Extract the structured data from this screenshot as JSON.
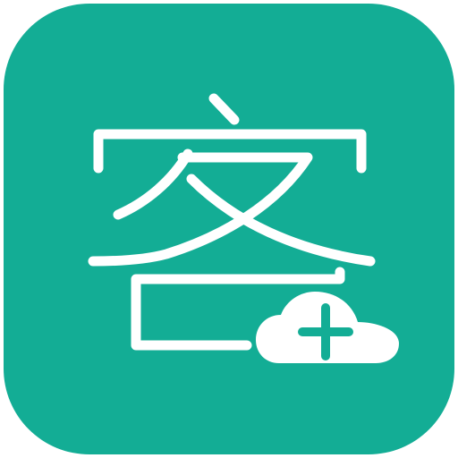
{
  "app_icon": {
    "glyph": "客",
    "badge_symbol": "+",
    "colors": {
      "background": "#13AD95",
      "glyph": "#FFFFFF",
      "badge_cloud": "#FFFFFF",
      "badge_plus": "#13AD95"
    },
    "badge_icon": "cloud-plus-icon"
  }
}
